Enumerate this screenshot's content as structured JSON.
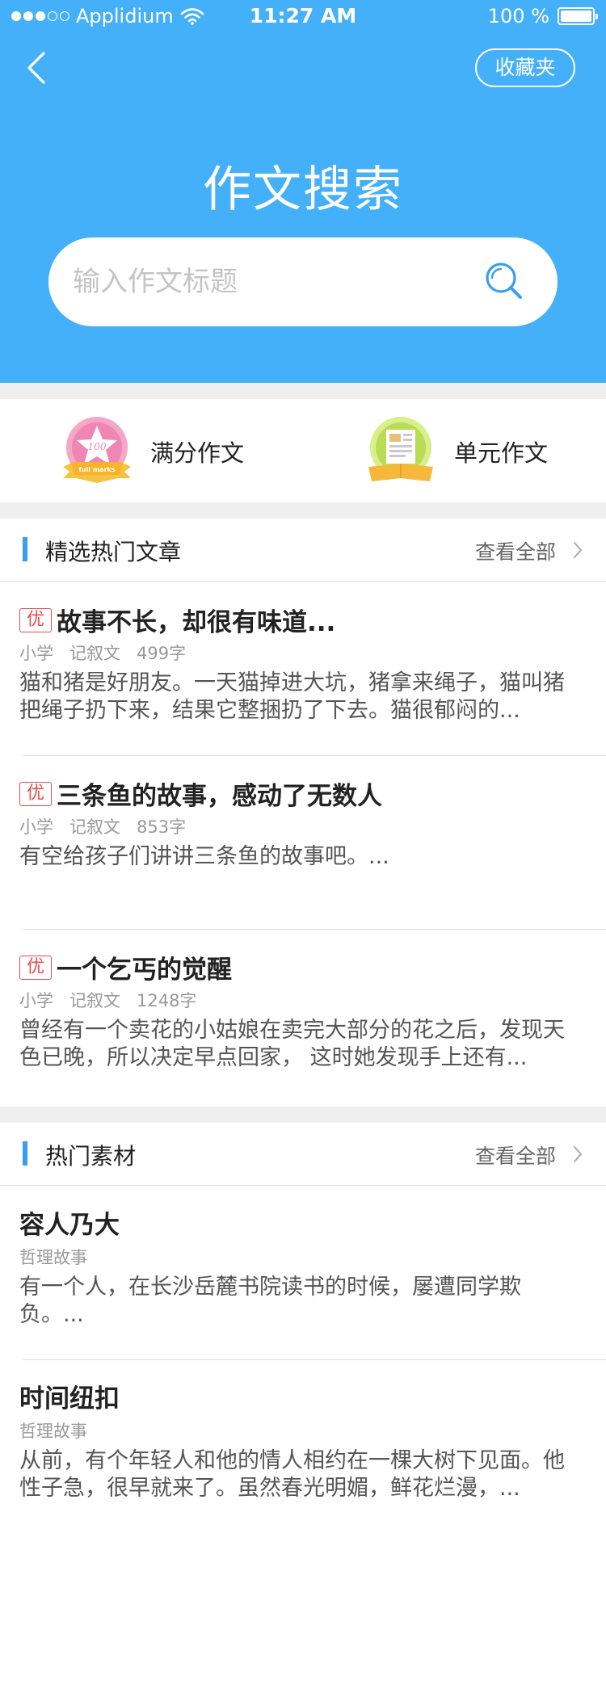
{
  "status_bar": {
    "carrier": "Applidium",
    "time": "11:27 AM",
    "battery": "100 %",
    "battery_level": 1.0
  },
  "header": {
    "title": "作文搜索",
    "favorites_label": "收藏夹"
  },
  "search": {
    "placeholder": "输入作文标题",
    "value": ""
  },
  "quick_links": [
    {
      "label": "满分作文",
      "icon": "full-score-badge-icon"
    },
    {
      "label": "单元作文",
      "icon": "unit-book-icon"
    }
  ],
  "hot_articles": {
    "title": "精选热门文章",
    "view_all": "查看全部",
    "items": [
      {
        "badge": "优",
        "title": "故事不长，却很有味道...",
        "level": "小学",
        "genre": "记叙文",
        "words": "499字",
        "excerpt": "猫和猪是好朋友。一天猫掉进大坑，猪拿来绳子，猫叫猪把绳子扔下来，结果它整捆扔了下去。猫很郁闷的..."
      },
      {
        "badge": "优",
        "title": "三条鱼的故事，感动了无数人",
        "level": "小学",
        "genre": "记叙文",
        "words": "853字",
        "excerpt": "有空给孩子们讲讲三条鱼的故事吧。..."
      },
      {
        "badge": "优",
        "title": "一个乞丐的觉醒",
        "level": "小学",
        "genre": "记叙文",
        "words": "1248字",
        "excerpt": "曾经有一个卖花的小姑娘在卖完大部分的花之后，发现天色已晚，所以决定早点回家， 这时她发现手上还有..."
      }
    ]
  },
  "hot_materials": {
    "title": "热门素材",
    "view_all": "查看全部",
    "items": [
      {
        "title": "容人乃大",
        "category": "哲理故事",
        "excerpt": "有一个人，在长沙岳麓书院读书的时候，屡遭同学欺负。..."
      },
      {
        "title": "时间纽扣",
        "category": "哲理故事",
        "excerpt": "从前，有个年轻人和他的情人相约在一棵大树下见面。他性子急，很早就来了。虽然春光明媚，鲜花烂漫，..."
      }
    ]
  },
  "colors": {
    "primary": "#45b0fa",
    "accent_bar": "#3a9ef0",
    "badge_red": "#e74b4b"
  }
}
